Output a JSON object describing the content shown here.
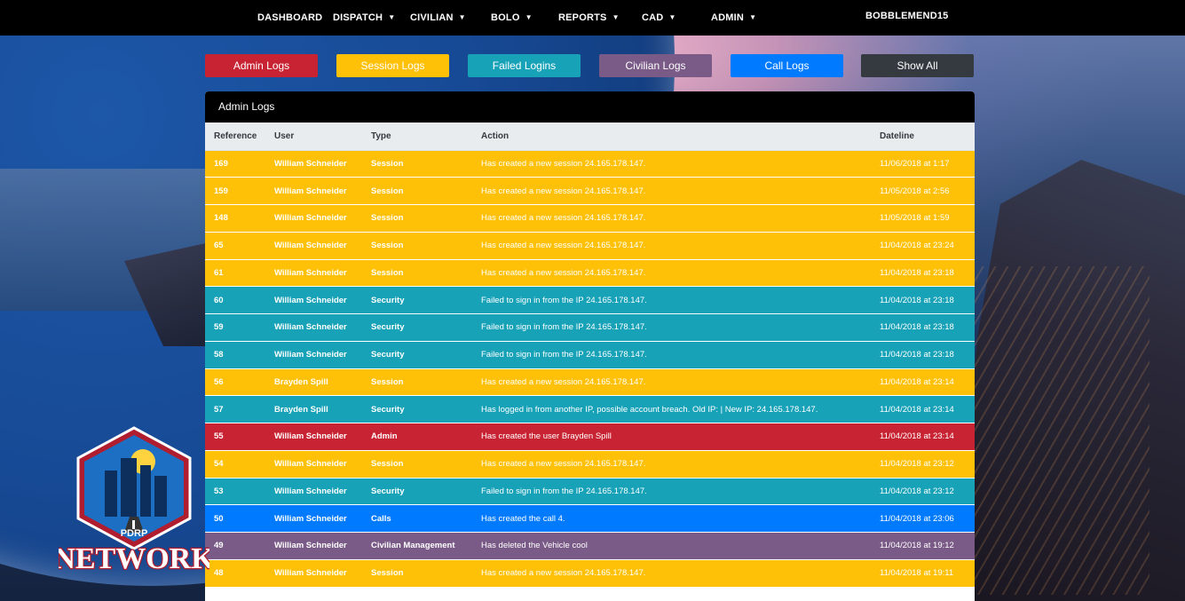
{
  "nav": {
    "items": [
      {
        "label": "DASHBOARD",
        "has_caret": false
      },
      {
        "label": "DISPATCH",
        "has_caret": true
      },
      {
        "label": "CIVILIAN",
        "has_caret": true
      },
      {
        "label": "BOLO",
        "has_caret": true
      },
      {
        "label": "REPORTS",
        "has_caret": true
      },
      {
        "label": "CAD",
        "has_caret": true
      },
      {
        "label": "ADMIN",
        "has_caret": true
      }
    ],
    "user": "BOBBLEMEND15"
  },
  "filters": [
    {
      "label": "Admin Logs",
      "color": "#c82333"
    },
    {
      "label": "Session Logs",
      "color": "#ffc107"
    },
    {
      "label": "Failed Logins",
      "color": "#17a2b8"
    },
    {
      "label": "Civilian Logs",
      "color": "#7a5a87"
    },
    {
      "label": "Call Logs",
      "color": "#007bff"
    },
    {
      "label": "Show All",
      "color": "#343a40"
    }
  ],
  "card": {
    "title": "Admin Logs",
    "columns": [
      "Reference",
      "User",
      "Type",
      "Action",
      "Dateline"
    ],
    "rows": [
      {
        "ref": "169",
        "user": "William Schneider",
        "type": "Session",
        "action": "Has created a new session 24.165.178.147.",
        "date": "11/06/2018 at 1:17"
      },
      {
        "ref": "159",
        "user": "William Schneider",
        "type": "Session",
        "action": "Has created a new session 24.165.178.147.",
        "date": "11/05/2018 at 2:56"
      },
      {
        "ref": "148",
        "user": "William Schneider",
        "type": "Session",
        "action": "Has created a new session 24.165.178.147.",
        "date": "11/05/2018 at 1:59"
      },
      {
        "ref": "65",
        "user": "William Schneider",
        "type": "Session",
        "action": "Has created a new session 24.165.178.147.",
        "date": "11/04/2018 at 23:24"
      },
      {
        "ref": "61",
        "user": "William Schneider",
        "type": "Session",
        "action": "Has created a new session 24.165.178.147.",
        "date": "11/04/2018 at 23:18"
      },
      {
        "ref": "60",
        "user": "William Schneider",
        "type": "Security",
        "action": "Failed to sign in from the IP 24.165.178.147.",
        "date": "11/04/2018 at 23:18"
      },
      {
        "ref": "59",
        "user": "William Schneider",
        "type": "Security",
        "action": "Failed to sign in from the IP 24.165.178.147.",
        "date": "11/04/2018 at 23:18"
      },
      {
        "ref": "58",
        "user": "William Schneider",
        "type": "Security",
        "action": "Failed to sign in from the IP 24.165.178.147.",
        "date": "11/04/2018 at 23:18"
      },
      {
        "ref": "56",
        "user": "Brayden Spill",
        "type": "Session",
        "action": "Has created a new session 24.165.178.147.",
        "date": "11/04/2018 at 23:14"
      },
      {
        "ref": "57",
        "user": "Brayden Spill",
        "type": "Security",
        "action": "Has logged in from another IP, possible account breach. Old IP: | New IP: 24.165.178.147.",
        "date": "11/04/2018 at 23:14"
      },
      {
        "ref": "55",
        "user": "William Schneider",
        "type": "Admin",
        "action": "Has created the user Brayden Spill",
        "date": "11/04/2018 at 23:14"
      },
      {
        "ref": "54",
        "user": "William Schneider",
        "type": "Session",
        "action": "Has created a new session 24.165.178.147.",
        "date": "11/04/2018 at 23:12"
      },
      {
        "ref": "53",
        "user": "William Schneider",
        "type": "Security",
        "action": "Failed to sign in from the IP 24.165.178.147.",
        "date": "11/04/2018 at 23:12"
      },
      {
        "ref": "50",
        "user": "William Schneider",
        "type": "Calls",
        "action": "Has created the call 4.",
        "date": "11/04/2018 at 23:06"
      },
      {
        "ref": "49",
        "user": "William Schneider",
        "type": "Civilian Management",
        "action": "Has deleted the Vehicle cool",
        "date": "11/04/2018 at 19:12"
      },
      {
        "ref": "48",
        "user": "William Schneider",
        "type": "Session",
        "action": "Has created a new session 24.165.178.147.",
        "date": "11/04/2018 at 19:11"
      }
    ]
  },
  "logo": {
    "top_text": "PDRP",
    "bottom_text": "NETWORK"
  }
}
